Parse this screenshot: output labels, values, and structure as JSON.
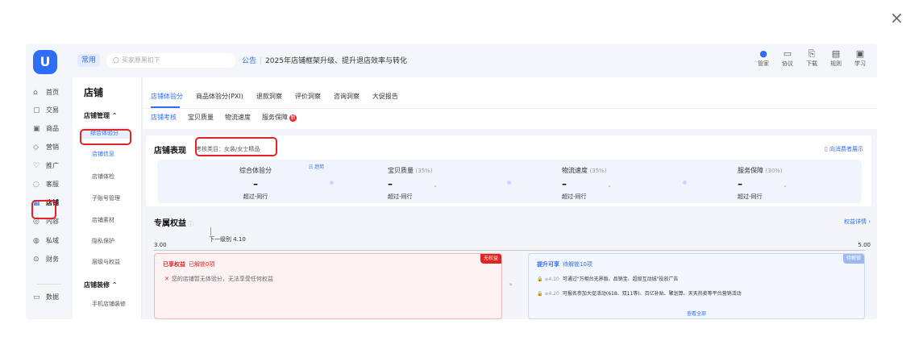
{
  "close_glyph": "×",
  "topbar": {
    "logo_letter": "U",
    "common_tag": "常用",
    "search_placeholder": "买家原黑扣下",
    "notice_label": "公告",
    "notice_text": "2025年店铺框架升级、提升退店效率与转化",
    "tools": [
      {
        "icon": "manager-icon",
        "glyph": "●",
        "label": "管家"
      },
      {
        "icon": "agreement-icon",
        "glyph": "▭",
        "label": "协议"
      },
      {
        "icon": "download-icon",
        "glyph": "⎘",
        "label": "下载"
      },
      {
        "icon": "rules-icon",
        "glyph": "▤",
        "label": "规则"
      },
      {
        "icon": "learn-icon",
        "glyph": "▣",
        "label": "学习"
      }
    ]
  },
  "leftnav": [
    {
      "icon": "home-icon",
      "glyph": "⌂",
      "label": "首页"
    },
    {
      "icon": "trade-icon",
      "glyph": "▢",
      "label": "交易"
    },
    {
      "icon": "goods-icon",
      "glyph": "▣",
      "label": "商品"
    },
    {
      "icon": "marketing-icon",
      "glyph": "◇",
      "label": "营销"
    },
    {
      "icon": "promote-icon",
      "glyph": "♡",
      "label": "推广"
    },
    {
      "icon": "service-icon",
      "glyph": "◌",
      "label": "客服"
    },
    {
      "icon": "store-icon",
      "glyph": "▦",
      "label": "店铺"
    },
    {
      "icon": "content-icon",
      "glyph": "◎",
      "label": "内容"
    },
    {
      "icon": "private-icon",
      "glyph": "◍",
      "label": "私域"
    },
    {
      "icon": "finance-icon",
      "glyph": "⊙",
      "label": "财务"
    },
    {
      "icon": "data-icon",
      "glyph": "▭",
      "label": "数据"
    }
  ],
  "subnav": {
    "title": "店铺",
    "group1": "店铺管理  ⌃",
    "items1": [
      "综合体验分",
      "店铺信息",
      "店铺体检",
      "子账号管理",
      "店铺素材",
      "隐私保护",
      "层级与权益"
    ],
    "group2": "店铺装修  ⌃",
    "items2": [
      "手机店铺装修"
    ]
  },
  "main": {
    "tabs1": [
      "店铺体验分",
      "商品体验分(PXI)",
      "退款洞察",
      "评价洞察",
      "咨询洞察",
      "大促报告"
    ],
    "tabs2": [
      "店铺考核",
      "宝贝质量",
      "物流速度",
      "服务保障"
    ],
    "tabs2_badge": "新",
    "perf": {
      "title": "店铺表现",
      "subtitle": "考核类目：女装/女士精品",
      "right_link": "▯ 向消费者展示",
      "trend": "☷ 趋势",
      "metrics": [
        {
          "name": "综合体验分",
          "pct": "",
          "value": "–",
          "compare": "超过-同行"
        },
        {
          "name": "宝贝质量",
          "pct": "(35%)",
          "value": "–",
          "compare": "超过-同行"
        },
        {
          "name": "物流速度",
          "pct": "(35%)",
          "value": "–",
          "compare": "超过-同行"
        },
        {
          "name": "服务保障",
          "pct": "(30%)",
          "value": "–",
          "compare": "超过-同行"
        }
      ]
    },
    "rights": {
      "title": "专属权益",
      "detail_link": "权益详情 ›",
      "scale_min": "3.00",
      "scale_max": "5.00",
      "next_level": "下一级别 4.10",
      "enjoyed_title": "已享权益",
      "enjoyed_count": "已解锁0项",
      "enjoyed_corner": "无权益",
      "enjoyed_msg": "您的店铺暂无体验分，无法享受任何权益",
      "arrows": "»",
      "upgrade_title": "提升可享",
      "upgrade_count": "待解锁10项",
      "upgrade_corner": "待解锁",
      "upgrade_rows": [
        {
          "level": "≥4.10",
          "text": "可通过\"万相台无界版、品销宝、超级互动城\"投放广告"
        },
        {
          "level": "≥4.20",
          "text": "可报名参加大促活动(618、双11等)、百亿补贴、聚划算、天天热卖等平台营销活动"
        }
      ],
      "see_all": "查看全部"
    }
  }
}
